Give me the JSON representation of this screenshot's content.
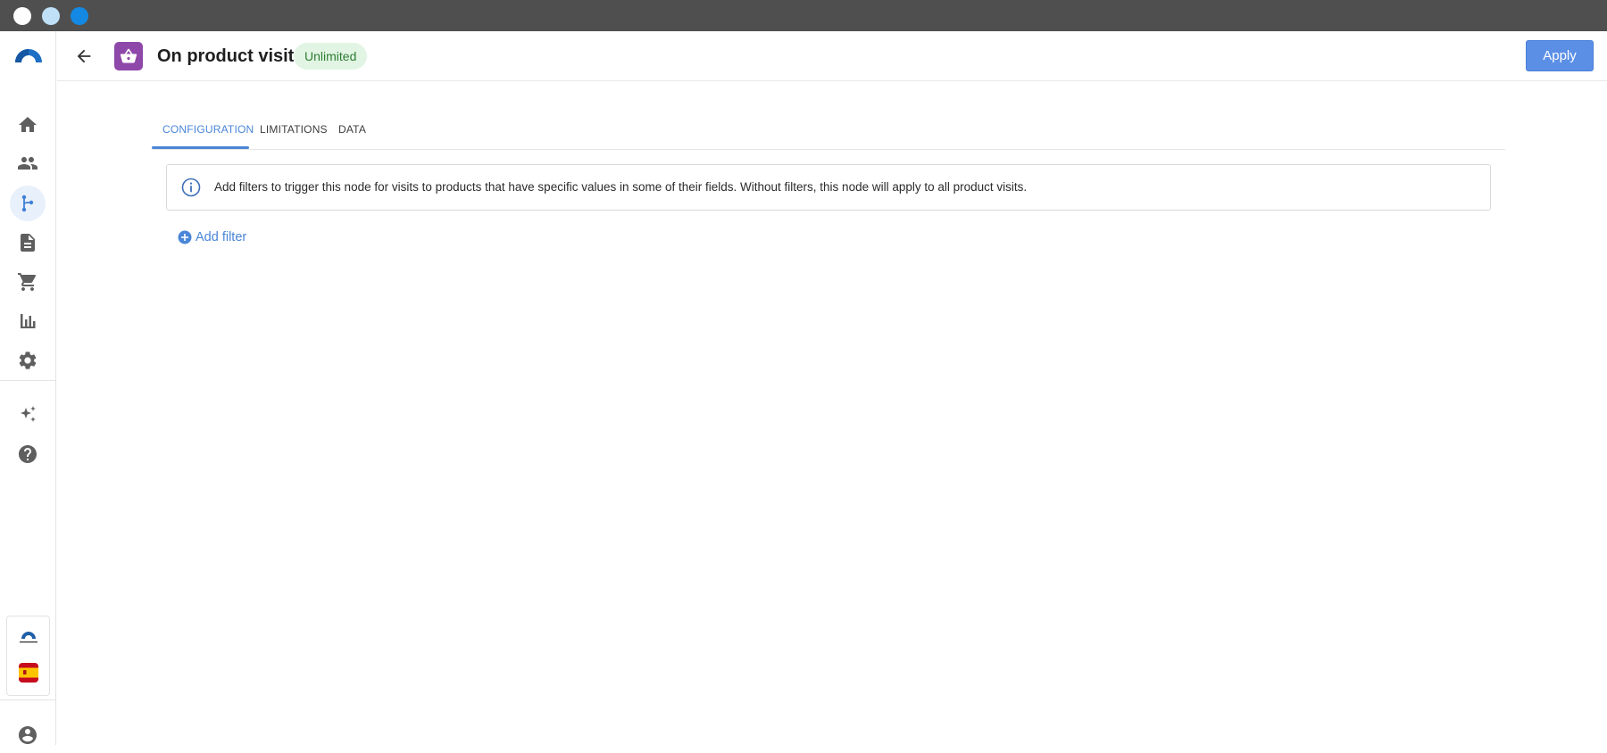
{
  "header": {
    "title": "On product visit",
    "badge": "Unlimited",
    "apply_label": "Apply"
  },
  "tabs": [
    {
      "label": "CONFIGURATION",
      "active": true
    },
    {
      "label": "LIMITATIONS",
      "active": false
    },
    {
      "label": "DATA",
      "active": false
    }
  ],
  "info": {
    "text": "Add filters to trigger this node for visits to products that have specific values in some of their fields. Without filters, this node will apply to all product visits."
  },
  "add_filter_label": "Add filter",
  "sidebar": {
    "items": [
      {
        "icon": "home-icon",
        "active": false
      },
      {
        "icon": "people-icon",
        "active": false
      },
      {
        "icon": "workflow-icon",
        "active": true
      },
      {
        "icon": "document-icon",
        "active": false
      },
      {
        "icon": "cart-icon",
        "active": false
      },
      {
        "icon": "bar-chart-icon",
        "active": false
      },
      {
        "icon": "gear-icon",
        "active": false
      },
      {
        "icon": "sparkles-icon",
        "active": false
      },
      {
        "icon": "help-icon",
        "active": false
      },
      {
        "icon": "account-icon",
        "active": false
      }
    ]
  },
  "colors": {
    "accent": "#4a86d8",
    "node_icon": "#8e48a9",
    "badge_bg": "#e2f5e4",
    "badge_text": "#2e7d32",
    "titlebar": "#4f4f4f"
  }
}
